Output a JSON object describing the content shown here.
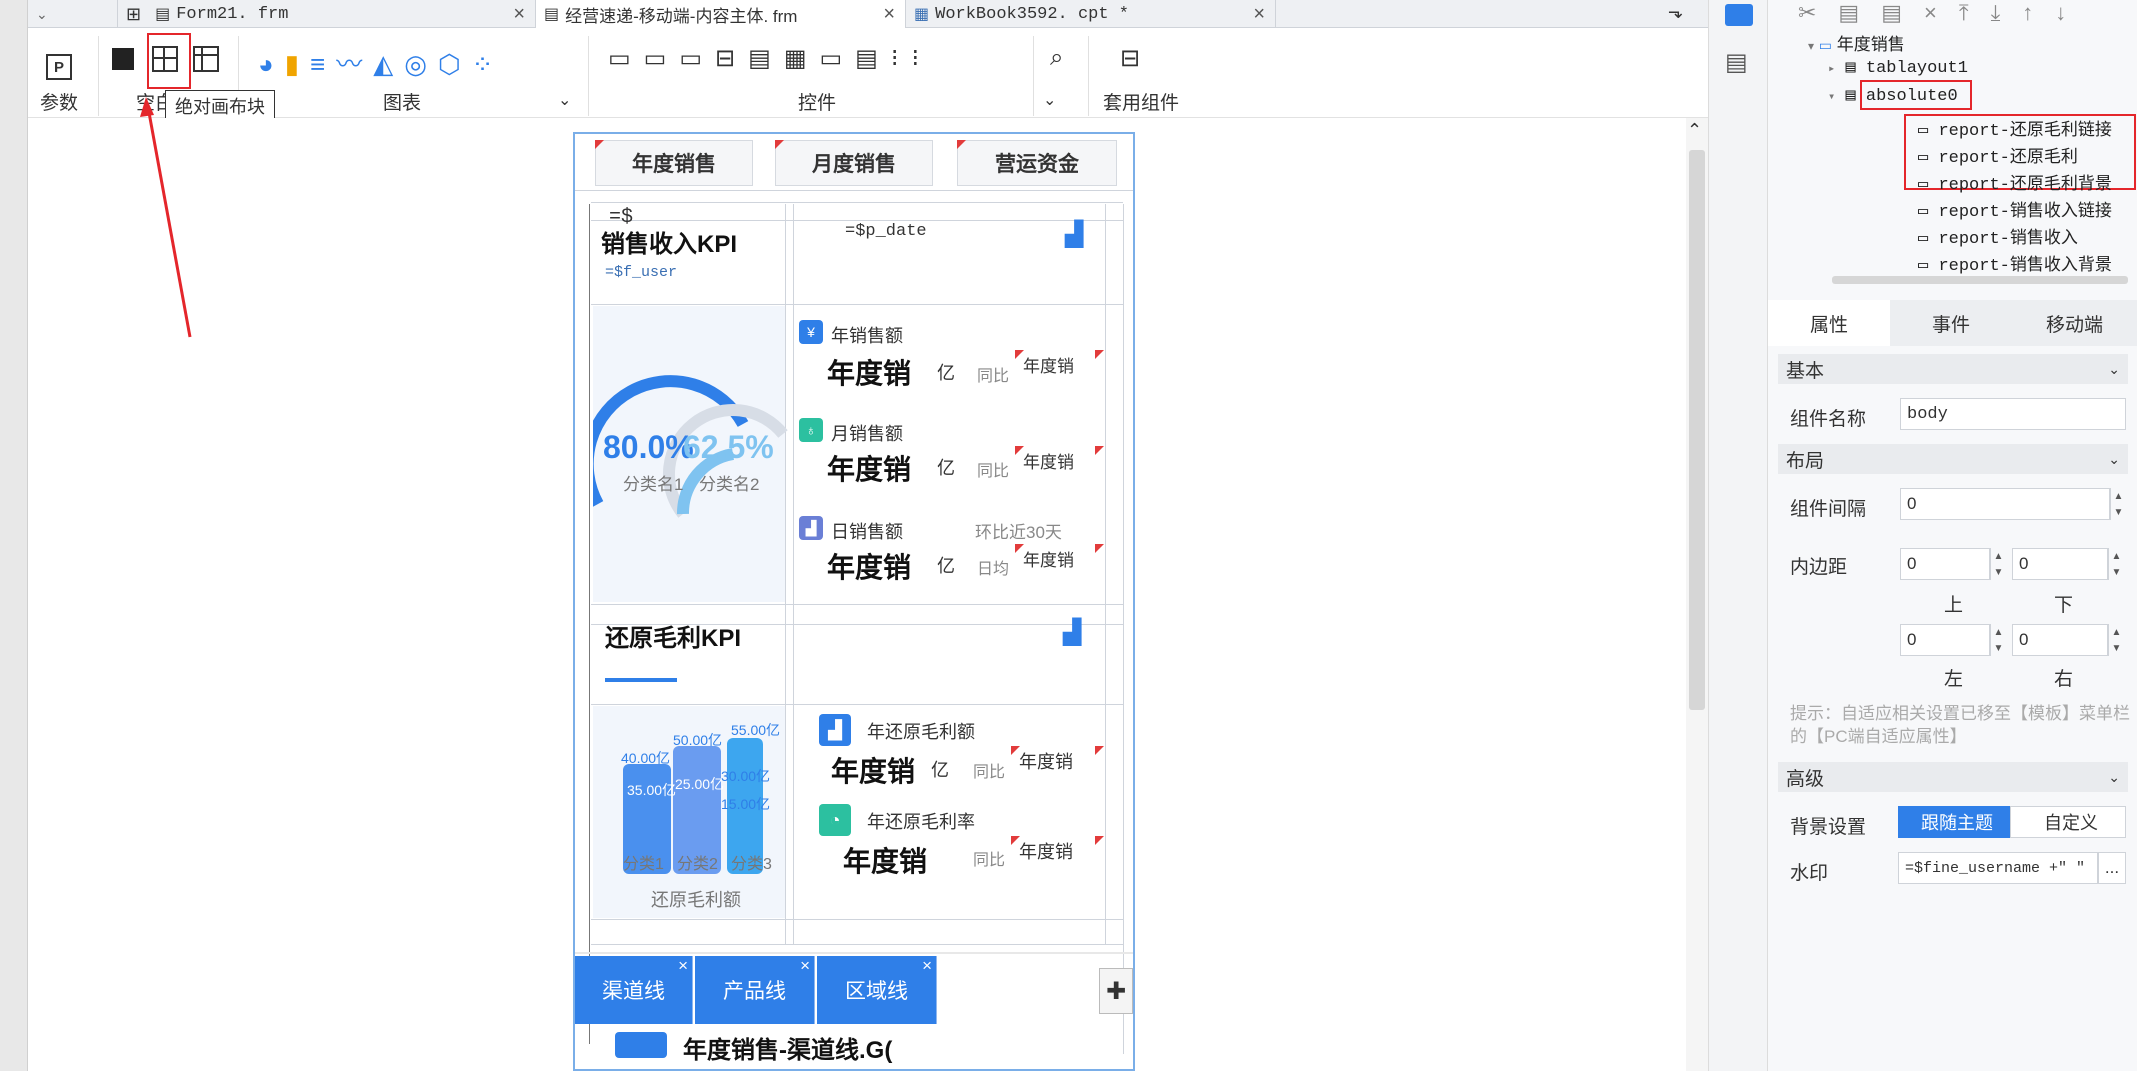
{
  "tabs": [
    {
      "label": "Form21. frm"
    },
    {
      "label": "经营速递-移动端-内容主体. frm"
    },
    {
      "label": "WorkBook3592. cpt *"
    }
  ],
  "toolbar": {
    "param_label": "参数",
    "blank_block_label": "空白",
    "chart_label": "图表",
    "widget_label": "控件",
    "template_component_label": "套用组件"
  },
  "tooltip": {
    "text": "绝对画布块"
  },
  "form": {
    "top_tabs": [
      "年度销售",
      "月度销售",
      "营运资金"
    ],
    "sales_kpi_title": "销售收入KPI",
    "param_dollar": "=$",
    "param_user": "=$f_user",
    "param_date": "=$p_date",
    "gauge_value1": "80.0%",
    "gauge_value2": "62.5%",
    "gauge_cat1": "分类名1",
    "gauge_cat2": "分类名2",
    "metric_rows": [
      {
        "header": "年销售额",
        "value": "年度销",
        "unit": "亿",
        "compare": "同比",
        "mini": "年度销"
      },
      {
        "header": "月销售额",
        "value": "年度销",
        "unit": "亿",
        "compare": "同比",
        "mini": "年度销"
      },
      {
        "header": "日销售额",
        "extra": "环比近30天",
        "value": "年度销",
        "unit": "亿",
        "compare": "日均",
        "mini": "年度销"
      }
    ],
    "gross_kpi_title": "还原毛利KPI",
    "bar_labels": [
      "55.00亿",
      "50.00亿",
      "40.00亿",
      "35.00亿",
      "25.00亿",
      "30.00亿",
      "25.00亿",
      "15.00亿"
    ],
    "bar_categories": [
      "分类1",
      "分类2",
      "分类3"
    ],
    "bar_chart_caption": "还原毛利额",
    "gross_rows": [
      {
        "header": "年还原毛利额",
        "value": "年度销",
        "unit": "亿",
        "compare": "同比",
        "mini": "年度销"
      },
      {
        "header": "年还原毛利率",
        "value": "年度销",
        "compare": "同比",
        "mini": "年度销"
      }
    ],
    "bottom_tabs": [
      "渠道线",
      "产品线",
      "区域线"
    ],
    "bottom_title": "年度销售-渠道线.G("
  },
  "tree": {
    "root": "年度销售",
    "tablayout": "tablayout1",
    "absolute": "absolute0",
    "reports": [
      "report-还原毛利链接",
      "report-还原毛利",
      "report-还原毛利背景",
      "report-销售收入链接",
      "report-销售收入",
      "report-销售收入背景"
    ]
  },
  "properties": {
    "tabs": [
      "属性",
      "事件",
      "移动端"
    ],
    "basic_section": "基本",
    "component_name_label": "组件名称",
    "component_name_value": "body",
    "layout_section": "布局",
    "gap_label": "组件间隔",
    "gap_value": "0",
    "padding_label": "内边距",
    "padding_top": "0",
    "padding_bottom": "0",
    "padding_left": "0",
    "padding_right": "0",
    "top_label": "上",
    "bottom_label": "下",
    "left_label": "左",
    "right_label": "右",
    "hint": "提示：自适应相关设置已移至【模板】菜单栏的【PC端自适应属性】",
    "advanced_section": "高级",
    "bg_label": "背景设置",
    "bg_option1": "跟随主题",
    "bg_option2": "自定义",
    "watermark_label": "水印",
    "watermark_value": "=$fine_username +\" \"",
    "more": "..."
  },
  "colors": {
    "accent": "#2f7fe8",
    "red": "#e4262b"
  }
}
